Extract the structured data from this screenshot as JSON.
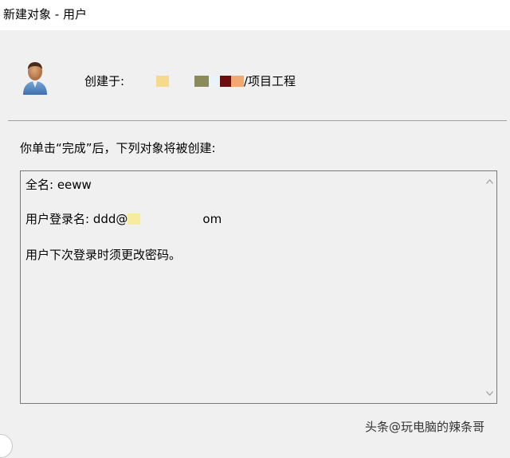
{
  "window": {
    "title": "新建对象 - 用户"
  },
  "header": {
    "icon": "user-icon",
    "created_label": "创建于:",
    "path_suffix": "/项目工程",
    "redacted_colors": [
      "#f5d98e",
      "#8a8a5a",
      "#e8f4f8",
      "#6b0e0e",
      "#f2a872"
    ]
  },
  "instruction": "你单击“完成”后，下列对象将被创建:",
  "summary": {
    "full_name": "全名: eeww",
    "login_prefix": "用户登录名: ddd@",
    "login_suffix": "om",
    "password_note": "用户下次登录时须更改密码。"
  },
  "watermark": {
    "text": "头条@玩电脑的辣条哥"
  }
}
